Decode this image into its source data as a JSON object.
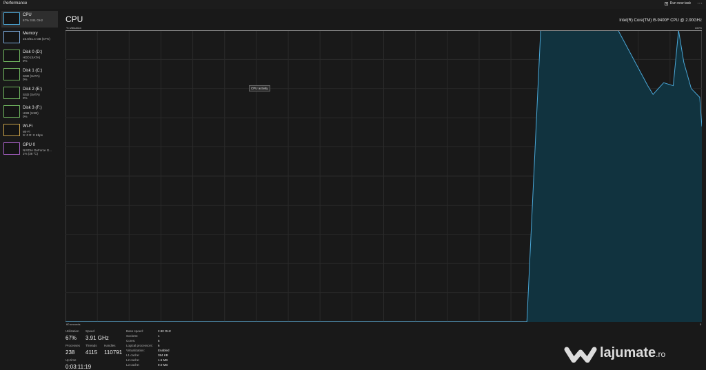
{
  "window": {
    "title": "Performance",
    "run_new_task": "Run new task",
    "more_icon": "more-icon"
  },
  "sidebar": {
    "items": [
      {
        "name": "CPU",
        "sub1": "67%  3.91 GHz",
        "sub2": "",
        "selected": true,
        "color": "#4aa8d8"
      },
      {
        "name": "Memory",
        "sub1": "15.0/31.4 GB (47%)",
        "sub2": "",
        "selected": false,
        "color": "#7aa7d8"
      },
      {
        "name": "Disk 0 (D:)",
        "sub1": "HDD (SATA)",
        "sub2": "0%",
        "selected": false,
        "color": "#6fb55f"
      },
      {
        "name": "Disk 1 (C:)",
        "sub1": "SSD (SATA)",
        "sub2": "0%",
        "selected": false,
        "color": "#6fb55f"
      },
      {
        "name": "Disk 2 (E:)",
        "sub1": "SSD (SATA)",
        "sub2": "0%",
        "selected": false,
        "color": "#6fb55f"
      },
      {
        "name": "Disk 3 (F:)",
        "sub1": "USB (USB)",
        "sub2": "0%",
        "selected": false,
        "color": "#6fb55f"
      },
      {
        "name": "Wi-Fi",
        "sub1": "Wi-Fi",
        "sub2": "S: 0 R: 0 Kbps",
        "selected": false,
        "color": "#c9a24a"
      },
      {
        "name": "GPU 0",
        "sub1": "NVIDIA GeForce G...",
        "sub2": "1% (38 °C)",
        "selected": false,
        "color": "#a45fc2"
      }
    ]
  },
  "main": {
    "title": "CPU",
    "model": "Intel(R) Core(TM) i5-9400F CPU @ 2.90GHz",
    "util_label": "% Utilization",
    "max_label": "100%",
    "time_label": "60 seconds",
    "min_label": "0",
    "tooltip": "CPU activity"
  },
  "chart_data": {
    "type": "area",
    "title": "CPU",
    "xlabel": "60 seconds",
    "ylabel": "% Utilization",
    "ylim": [
      0,
      100
    ],
    "xlim": [
      0,
      60
    ],
    "grid": true,
    "color": "#4aa8d8",
    "x": [
      0,
      43.5,
      44.8,
      52.1,
      54.9,
      55.4,
      56.4,
      57.3,
      57.8,
      58.3,
      59.0,
      59.8,
      60
    ],
    "y": [
      0,
      0,
      100,
      100,
      81,
      78,
      82,
      81,
      100,
      89,
      80,
      77,
      67
    ]
  },
  "stats": {
    "utilization": {
      "label": "Utilization",
      "value": "67%"
    },
    "speed": {
      "label": "Speed",
      "value": "3.91 GHz"
    },
    "processes": {
      "label": "Processes",
      "value": "238"
    },
    "threads": {
      "label": "Threads",
      "value": "4115"
    },
    "handles": {
      "label": "Handles",
      "value": "110791"
    },
    "uptime": {
      "label": "Up time",
      "value": "0:03:11:19"
    },
    "details": [
      {
        "k": "Base speed:",
        "v": "2.90 GHz"
      },
      {
        "k": "Sockets:",
        "v": "1"
      },
      {
        "k": "Cores:",
        "v": "6"
      },
      {
        "k": "Logical processors:",
        "v": "6"
      },
      {
        "k": "Virtualization:",
        "v": "Enabled"
      },
      {
        "k": "L1 cache:",
        "v": "384 KB"
      },
      {
        "k": "L2 cache:",
        "v": "1.5 MB"
      },
      {
        "k": "L3 cache:",
        "v": "9.0 MB"
      }
    ]
  },
  "watermark": {
    "text": "lajumate",
    "suffix": ".ro"
  }
}
